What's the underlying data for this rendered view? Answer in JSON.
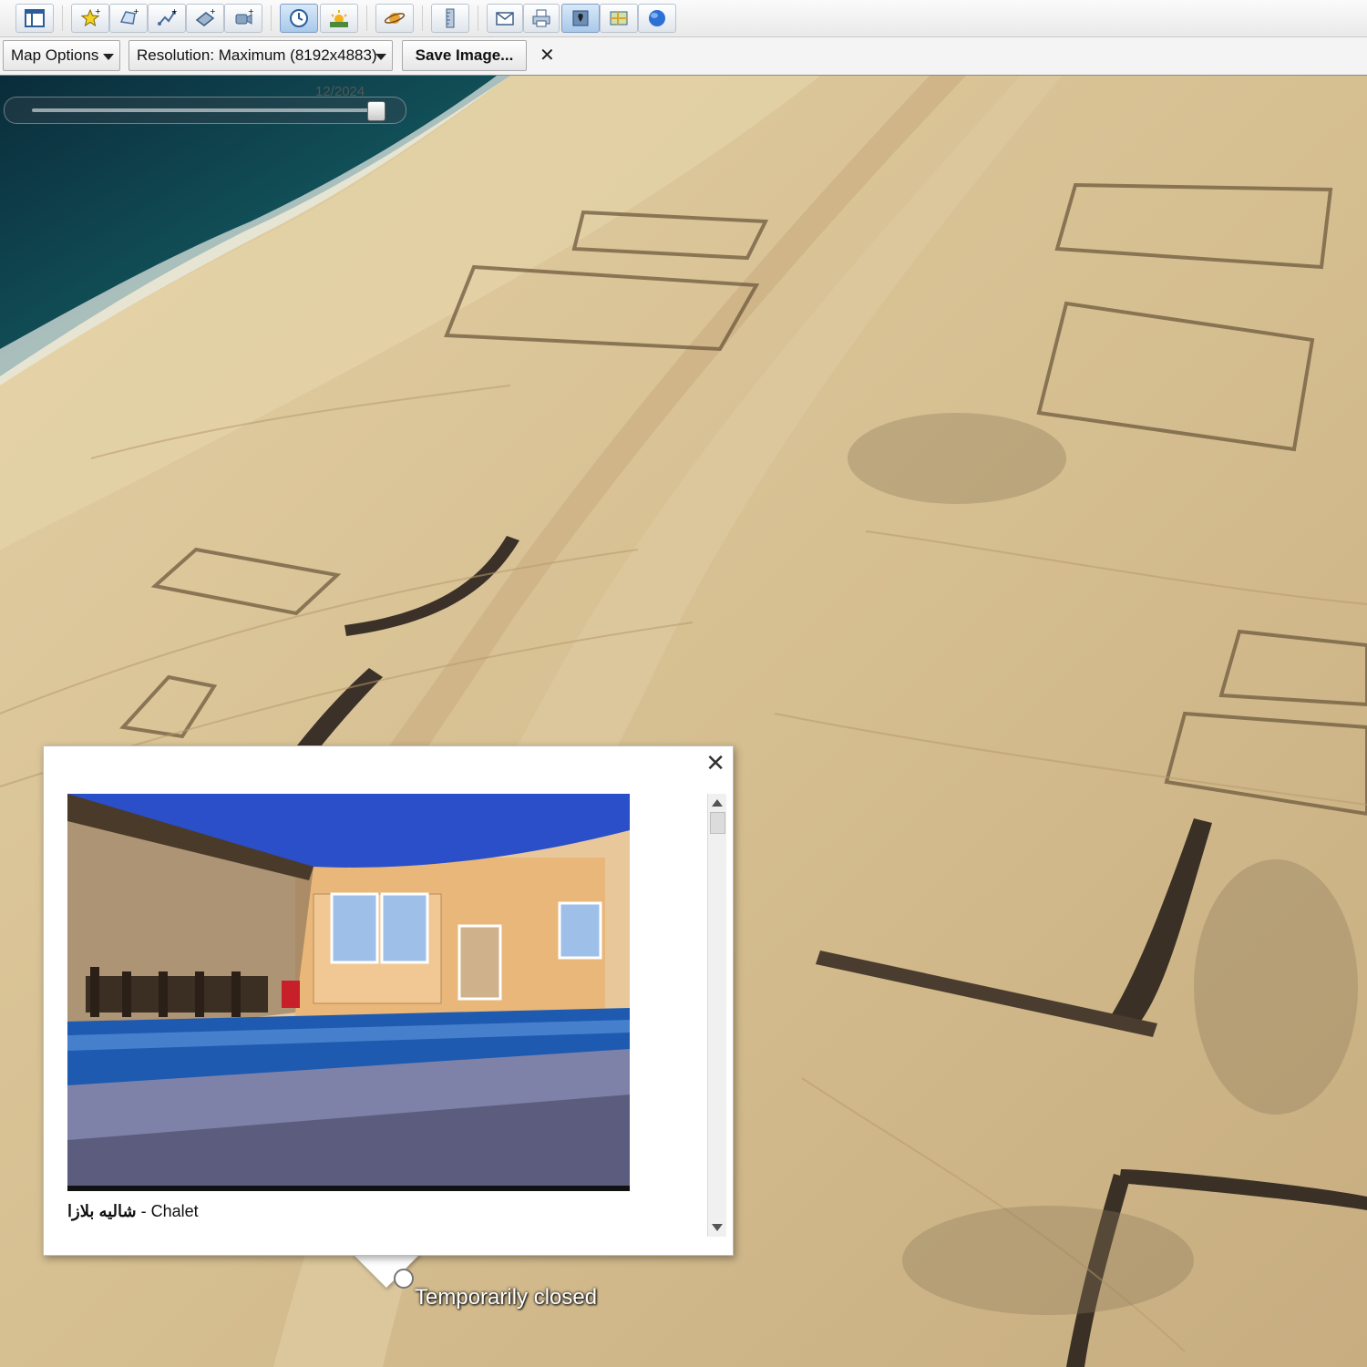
{
  "toolbar": {
    "buttons": [
      {
        "name": "sidebar-toggle-icon"
      },
      {
        "name": "add-placemark-icon"
      },
      {
        "name": "add-polygon-icon"
      },
      {
        "name": "add-path-icon"
      },
      {
        "name": "add-image-overlay-icon"
      },
      {
        "name": "record-tour-icon"
      },
      {
        "name": "historical-imagery-icon",
        "active": true
      },
      {
        "name": "sunlight-icon"
      },
      {
        "name": "planets-icon"
      },
      {
        "name": "ruler-icon"
      },
      {
        "name": "email-icon"
      },
      {
        "name": "print-icon"
      },
      {
        "name": "save-image-icon",
        "active": true
      },
      {
        "name": "view-in-maps-icon"
      },
      {
        "name": "earth-gallery-icon"
      }
    ]
  },
  "options_bar": {
    "map_options_label": "Map Options",
    "resolution_label": "Resolution: Maximum (8192x4883)",
    "save_image_label": "Save Image...",
    "close_label": "✕"
  },
  "map": {
    "time_slider_date": "12/2024",
    "place_label": "Temporarily closed"
  },
  "popup": {
    "close_label": "✕",
    "caption_arabic": "شاليه بلازا",
    "caption_separator": " - ",
    "caption_english": "Chalet"
  },
  "colors": {
    "sand": "#d9c296",
    "sea_deep": "#0c3a44",
    "sea_shallow": "#2e8a86",
    "toolbar_active": "#a9c8ea",
    "pool_blue": "#1d5ab0"
  }
}
